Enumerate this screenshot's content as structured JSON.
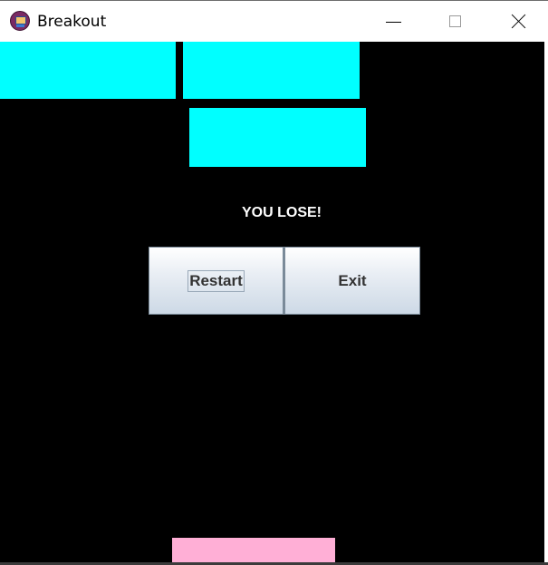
{
  "window": {
    "title": "Breakout",
    "icon": "breakout-app-icon",
    "controls": {
      "minimize": "minimize-icon",
      "maximize": "maximize-icon",
      "close": "close-icon"
    }
  },
  "game": {
    "background_color": "#000000",
    "brick_color": "#00ffff",
    "paddle_color": "#ffafd6",
    "bricks_remaining": 3,
    "message": "YOU LOSE!",
    "buttons": {
      "restart_label": "Restart",
      "exit_label": "Exit"
    }
  }
}
